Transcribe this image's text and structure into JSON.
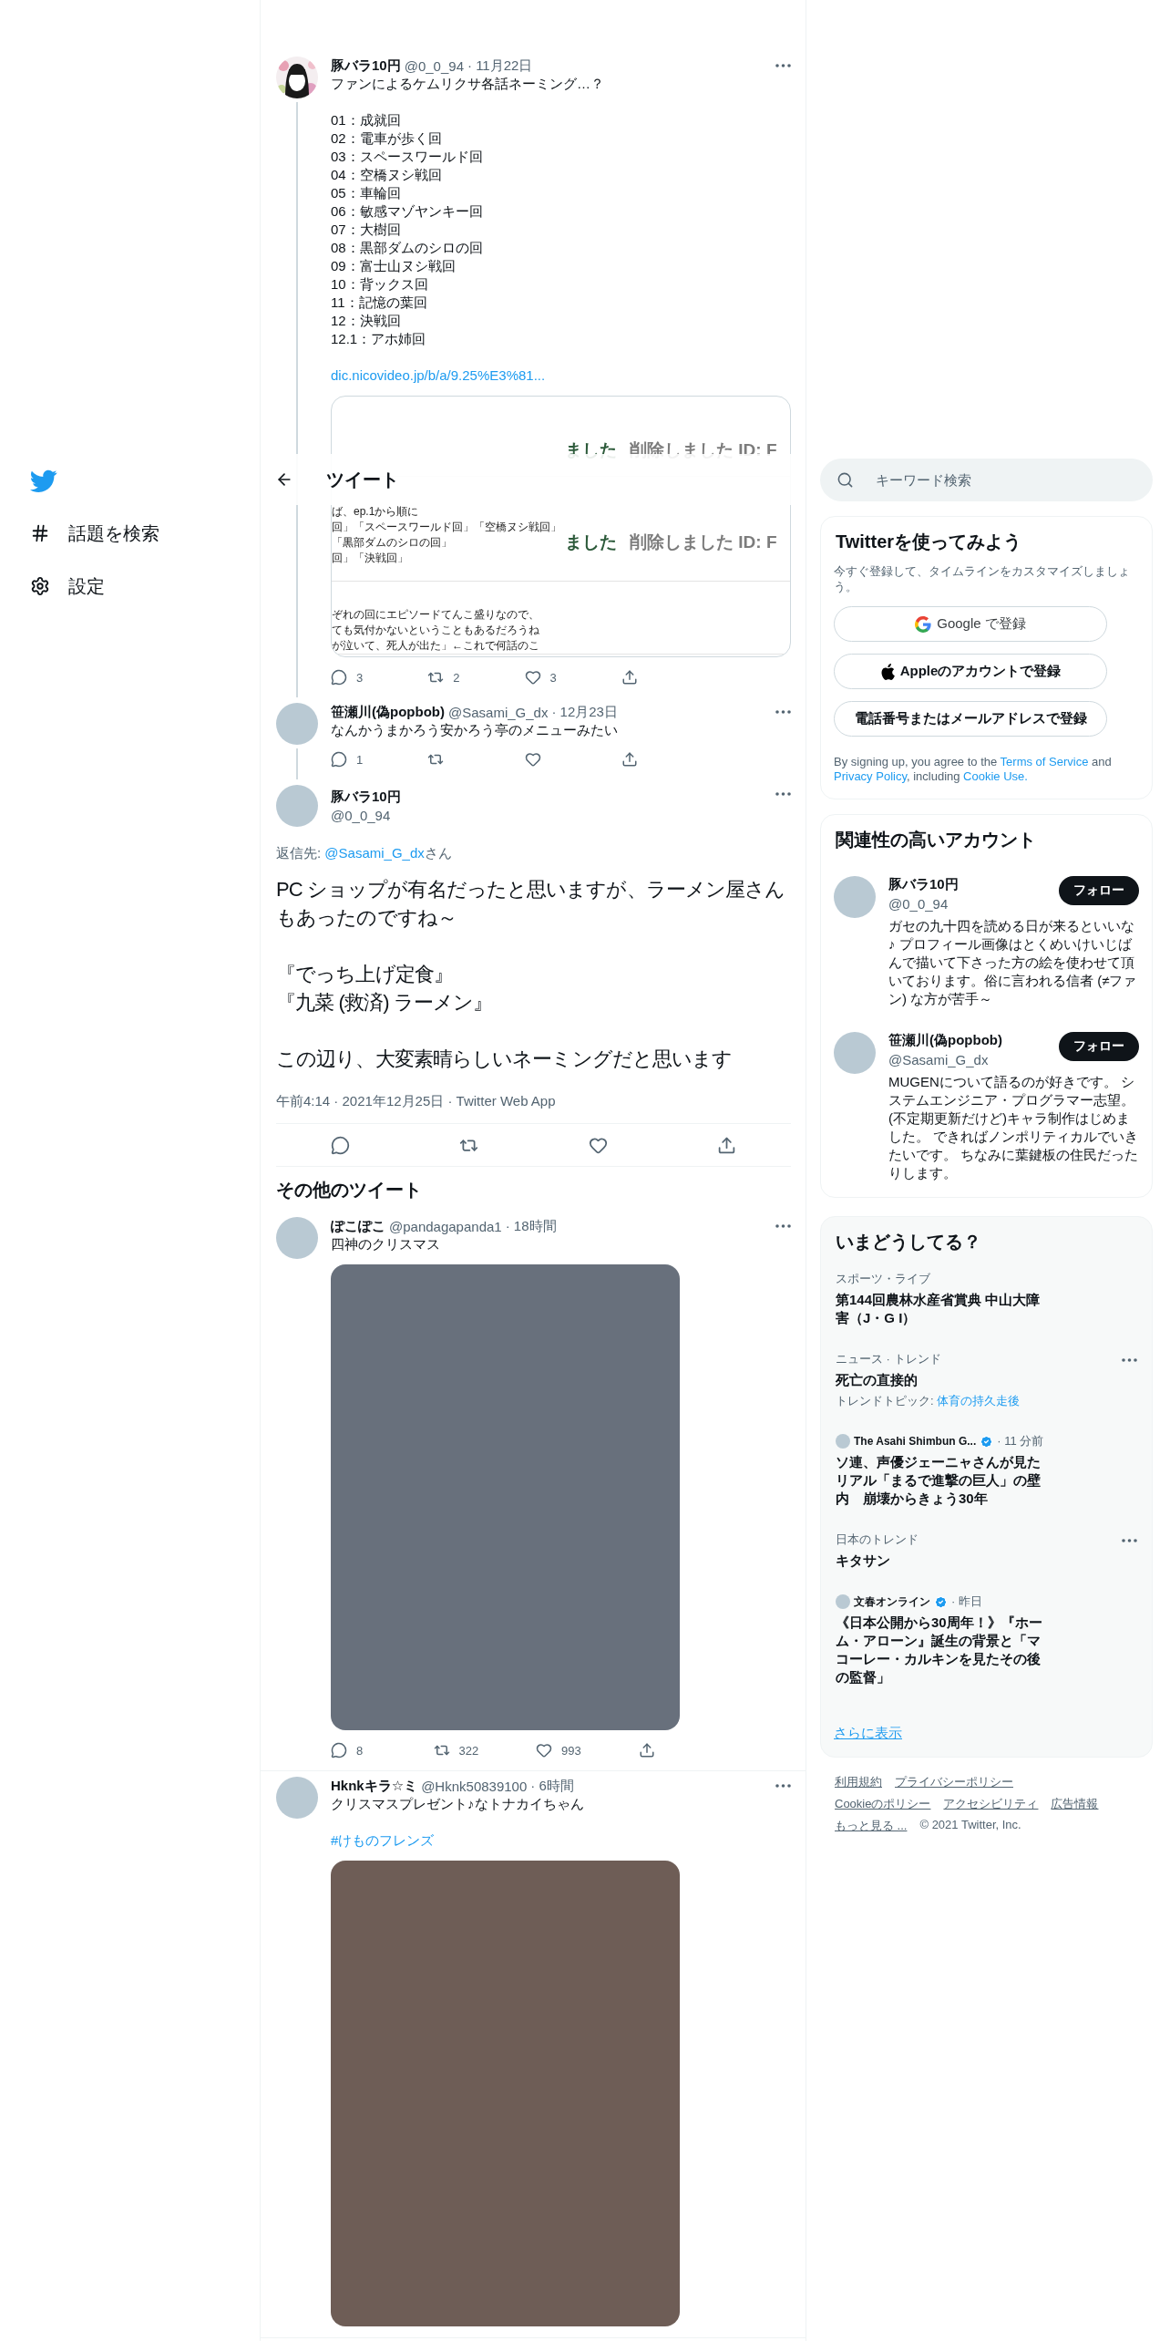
{
  "sidebar": {
    "items": [
      {
        "kind": "logo"
      },
      {
        "kind": "explore",
        "label": "話題を検索"
      },
      {
        "kind": "settings",
        "label": "設定"
      }
    ]
  },
  "header": {
    "title": "ツイート"
  },
  "thread": [
    {
      "name": "豚バラ10円",
      "handle": "@0_0_94",
      "time": "· 11月22日",
      "text": "ファンによるケムリクサ各話ネーミング…？\n\n01：成就回\n02：電車が歩く回\n03：スペースワールド回\n04：空橋ヌシ戦回\n05：車輪回\n06：敏感マゾヤンキー回\n07：大樹回\n08：黒部ダムのシロの回\n09：富士山ヌシ戦回\n10：背ックス回\n11：記憶の葉回\n12：決戦回\n12.1：アホ姉回",
      "link": "dic.nicovideo.jp/b/a/9.25%E3%81...",
      "card": {
        "top_label": "ました",
        "top_note": "削除しました ID: F",
        "mid_lines": [
          "ば、ep.1から順に",
          "回」「スペースワールド回」「空橋ヌシ戦回」",
          "「黒部ダムのシロの回」",
          "回」「決戦回」"
        ],
        "mid_label": "ました",
        "mid_note": "削除しました ID: F",
        "bottom_lines": [
          "ぞれの回にエピソードてんこ盛りなので、",
          "ても気付かないということもあるだろうね",
          "が泣いて、死人が出た」←これで何話のこ"
        ]
      },
      "actions": {
        "reply": "3",
        "retweet": "2",
        "like": "3"
      }
    },
    {
      "avatar": {
        "kind": "plain"
      },
      "name": "笹瀬川(偽popbob)",
      "handle": "@Sasami_G_dx",
      "time": "· 12月23日",
      "text": "なんかうまかろう安かろう亭のメニューみたい",
      "actions": {
        "reply": "1"
      }
    }
  ],
  "focused": {
    "name": "豚バラ10円",
    "handle": "@0_0_94",
    "reply_to": [
      {
        "text": "返信先: ",
        "link": false
      },
      {
        "text": "@Sasami_G_dx",
        "link": true
      },
      {
        "text": "さん",
        "link": false
      }
    ],
    "paragraphs": [
      [
        "PC ショップが有名だったと思いますが、ラーメン屋さんもあったのですね～"
      ],
      [
        "『でっち上げ定食』",
        "『九菜 (救済) ラーメン』"
      ],
      [
        "この辺り、大変素晴らしいネーミングだと思います"
      ]
    ],
    "meta": "午前4:14 · 2021年12月25日 · Twitter Web App"
  },
  "more_tweets": {
    "title": "その他のツイート",
    "tweets": [
      {
        "name": "ぽこぽこ",
        "handle": "@pandagapanda1",
        "time": "· 18時間",
        "text": "四神のクリスマス",
        "media": {
          "color": "#68707c"
        },
        "actions": {
          "reply": "8",
          "retweet": "322",
          "like": "993"
        }
      },
      {
        "name": "Hknkキラ☆ミ",
        "handle": "@Hknk50839100",
        "time": "· 6時間",
        "text": "クリスマスプレゼント♪なトナカイちゃん",
        "hashtag": "#けものフレンズ",
        "media": {
          "color": "#6e5d56"
        }
      }
    ]
  },
  "search": {
    "placeholder": "キーワード検索"
  },
  "signup": {
    "title": "Twitterを使ってみよう",
    "subtitle": "今すぐ登録して、タイムラインをカスタマイズしましょう。",
    "buttons": [
      {
        "kind": "google",
        "label": "Google で登録"
      },
      {
        "kind": "apple",
        "label": "Appleのアカウントで登録"
      },
      {
        "kind": "plain",
        "label": "電話番号またはメールアドレスで登録"
      }
    ],
    "terms": [
      {
        "text": "By signing up, you agree to the ",
        "link": false
      },
      {
        "text": "Terms of Service",
        "link": true
      },
      {
        "text": " and ",
        "link": false
      },
      {
        "text": "Privacy Policy",
        "link": true
      },
      {
        "text": ", including ",
        "link": false
      },
      {
        "text": "Cookie Use.",
        "link": true
      }
    ]
  },
  "who_to_follow": {
    "title": "関連性の高いアカウント",
    "accounts": [
      {
        "name": "豚バラ10円",
        "handle": "@0_0_94",
        "bio": "ガセの九十四を読める日が来るといいな♪ プロフィール画像はとくめいけいじばんで描いて下さった方の絵を使わせて頂いております。俗に言われる信者 (≠ファン) な方が苦手～",
        "button": "フォロー"
      },
      {
        "name": "笹瀬川(偽popbob)",
        "handle": "@Sasami_G_dx",
        "bio": "MUGENについて語るのが好きです。 システムエンジニア・プログラマー志望。 (不定期更新だけど)キャラ制作はじめました。 できればノンポリティカルでいきたいです。 ちなみに葉鍵板の住民だったりします。",
        "button": "フォロー"
      }
    ]
  },
  "trends": {
    "title": "いまどうしてる？",
    "items": [
      {
        "kind": "trend",
        "category": "スポーツ・ライブ",
        "title": "第144回農林水産省賞典 中山大障害（J・G I）",
        "menu": false
      },
      {
        "kind": "trend",
        "category": "ニュース · トレンド",
        "title": "死亡の直接的",
        "topic_label": "トレンドトピック: ",
        "topic": "体育の持久走後",
        "menu": true
      },
      {
        "kind": "news",
        "source": "The Asahi Shimbun G...",
        "verified": true,
        "time": "· 11 分前",
        "title": "ソ連、声優ジェーニャさんが見たリアル「まるで進撃の巨人」の壁内　崩壊からきょう30年"
      },
      {
        "kind": "trend",
        "category": "日本のトレンド",
        "title": "キタサン",
        "menu": true
      },
      {
        "kind": "news",
        "source": "文春オンライン",
        "verified": true,
        "time": "· 昨日",
        "title": "《日本公開から30周年！》『ホーム・アローン』誕生の背景と「マコーレー・カルキンを見たその後の監督」"
      }
    ],
    "more": "さらに表示"
  },
  "footer": {
    "links": [
      "利用規約",
      "プライバシーポリシー",
      "Cookieのポリシー",
      "アクセシビリティ",
      "広告情報",
      "もっと見る ..."
    ],
    "copyright": "© 2021 Twitter, Inc."
  }
}
